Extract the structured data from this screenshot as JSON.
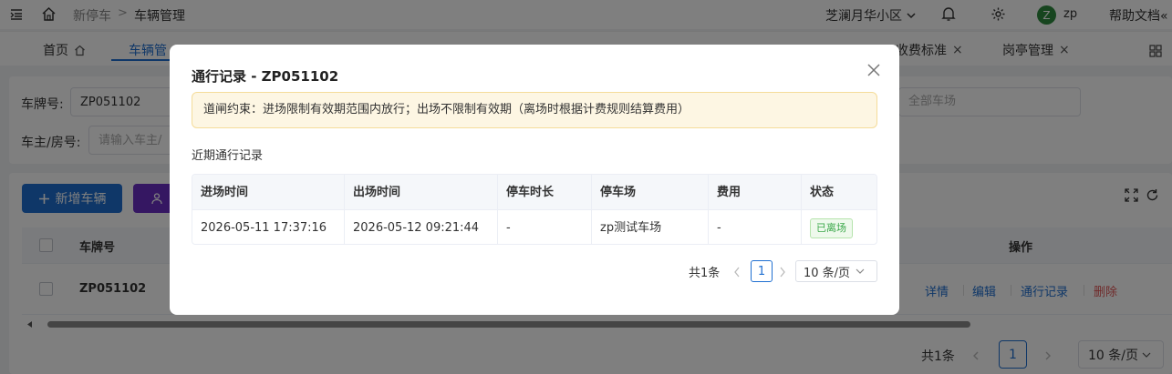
{
  "topbar": {
    "breadcrumb_system": "新停车",
    "breadcrumb_sep": ">",
    "breadcrumb_current": "车辆管理",
    "community": "芝澜月华小区",
    "avatar_letter": "Z",
    "user": "zp",
    "help": "帮助文档«"
  },
  "tabs": {
    "home": "首页",
    "vehicle": "车辆管",
    "fee_standard": "收费标准",
    "booth": "岗亭管理",
    "close": "×"
  },
  "filter": {
    "plate_label": "车牌号:",
    "plate_value": "ZP051102",
    "owner_label": "车主/房号:",
    "owner_placeholder": "请输入车主/",
    "lot_placeholder": "全部车场"
  },
  "toolbar": {
    "add_label": "新增车辆"
  },
  "table": {
    "head_plate": "车牌号",
    "head_ops": "操作",
    "rows": [
      {
        "plate": "ZP051102",
        "op_detail": "详情",
        "op_edit": "编辑",
        "op_records": "通行记录",
        "op_delete": "删除"
      }
    ]
  },
  "pager": {
    "total": "共1条",
    "page": "1",
    "size": "10 条/页"
  },
  "modal": {
    "title": "通行记录 - ZP051102",
    "alert": "道闸约束：进场限制有效期范围内放行；出场不限制有效期（离场时根据计费规则结算费用）",
    "section_title": "近期通行记录",
    "columns": [
      "进场时间",
      "出场时间",
      "停车时长",
      "停车场",
      "费用",
      "状态"
    ],
    "records": [
      {
        "entry": "2026-05-11 17:37:16",
        "exit": "2026-05-12 09:21:44",
        "duration": "-",
        "lot": "zp测试车场",
        "fee": "-",
        "status": "已离场"
      }
    ],
    "pager": {
      "total": "共1条",
      "page": "1",
      "size": "10 条/页"
    }
  },
  "colors": {
    "primary": "#1f6fd1",
    "purple": "#6a2fc4",
    "danger": "#e05555",
    "success": "#3ba84a",
    "alert_bg": "#fdf6e3"
  }
}
